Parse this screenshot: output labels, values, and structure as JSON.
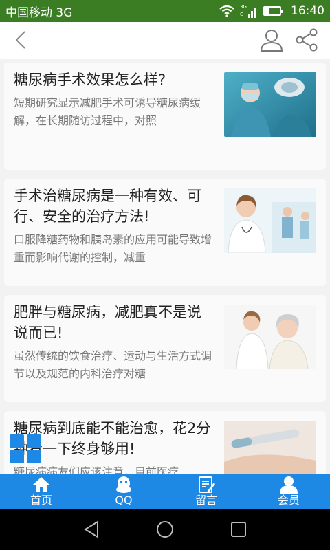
{
  "status_bar": {
    "carrier": "中国移动 3G",
    "time": "16:40",
    "network_badge": "3G",
    "battery_level": 0.2
  },
  "articles": [
    {
      "title": "糖尿病手术效果怎么样?",
      "desc": "短期研究显示减肥手术可诱导糖尿病缓解，在长期随访过程中，对照"
    },
    {
      "title": "手术治糖尿病是一种有效、可行、安全的治疗方法!",
      "desc": "口服降糖药物和胰岛素的应用可能导致增重而影响代谢的控制，减重"
    },
    {
      "title": "肥胖与糖尿病，减肥真不是说说而已!",
      "desc": "虽然传统的饮食治疗、运动与生活方式调节以及规范的内科治疗对糖"
    },
    {
      "title": "糖尿病到底能不能治愈，花2分钟看一下终身够用!",
      "desc": "糖尿病病友们应该注意，目前医疗"
    }
  ],
  "tabs": [
    {
      "label": "首页",
      "icon": "home-icon"
    },
    {
      "label": "QQ",
      "icon": "qq-icon"
    },
    {
      "label": "留言",
      "icon": "message-edit-icon"
    },
    {
      "label": "会员",
      "icon": "member-icon"
    }
  ],
  "colors": {
    "status_bar": "#3a7d23",
    "tab_bar": "#1e88e5",
    "title_text": "#222222",
    "desc_text": "#777777"
  }
}
